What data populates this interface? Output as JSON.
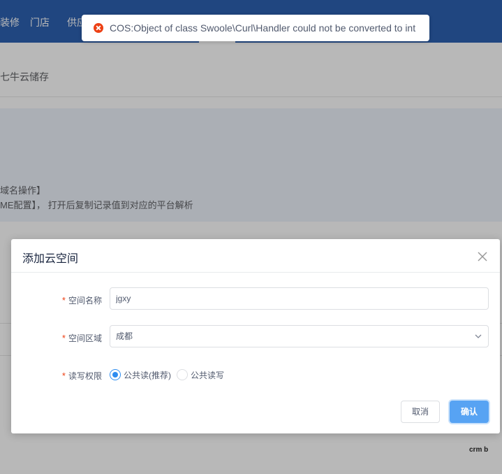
{
  "topbar": {
    "nav": [
      "装修",
      "门店",
      "供应"
    ]
  },
  "breadcrumb": {
    "text": "七牛云储存"
  },
  "notice": {
    "line1": "域名操作】",
    "line2": "ME配置】， 打开后复制记录值到对应的平台解析"
  },
  "toast": {
    "type": "error",
    "icon": "error-circle-icon",
    "message": "COS:Object of class Swoole\\Curl\\Handler could not be converted to int"
  },
  "modal": {
    "title": "添加云空间",
    "close_icon": "close-icon",
    "fields": {
      "name": {
        "label": "空间名称",
        "value": "jgxy"
      },
      "region": {
        "label": "空间区域",
        "value": "成都"
      },
      "permission": {
        "label": "读写权限",
        "options": [
          {
            "label": "公共读(推荐)",
            "checked": true
          },
          {
            "label": "公共读写",
            "checked": false
          }
        ]
      }
    },
    "buttons": {
      "cancel": "取消",
      "confirm": "确认"
    }
  },
  "brand": {
    "text": "crm b"
  },
  "colors": {
    "primary": "#2d8cf0",
    "topbar": "#2d62b2",
    "error": "#ed4014",
    "required": "#ed4014"
  }
}
